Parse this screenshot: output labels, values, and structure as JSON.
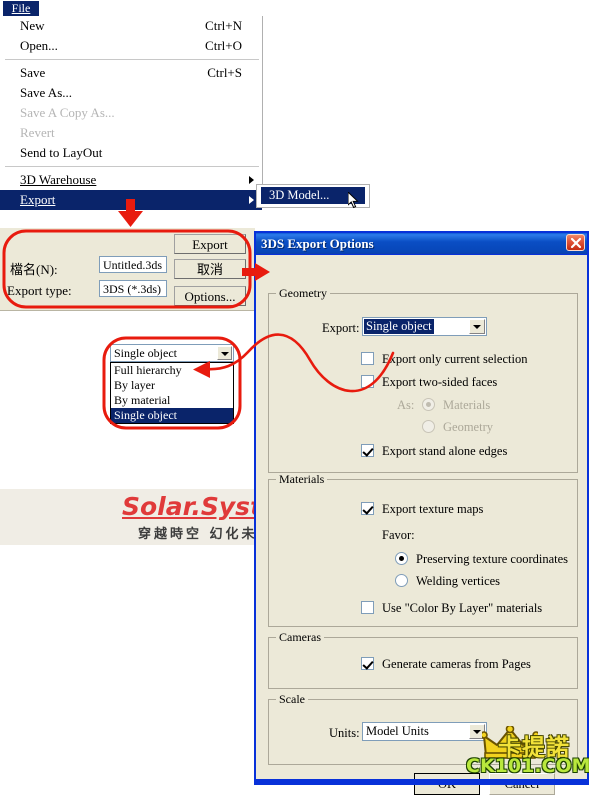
{
  "file_menu": {
    "title": "File",
    "title_underline_char": "F",
    "items": [
      {
        "label": "New",
        "accel": "Ctrl+N",
        "state": "normal",
        "underline": "N"
      },
      {
        "label": "Open...",
        "accel": "Ctrl+O",
        "state": "normal",
        "underline": "O"
      },
      {
        "separator": true
      },
      {
        "label": "Save",
        "accel": "Ctrl+S",
        "state": "normal",
        "underline": "S"
      },
      {
        "label": "Save As...",
        "accel": "",
        "state": "normal",
        "underline": ""
      },
      {
        "label": "Save A Copy As...",
        "accel": "",
        "state": "disabled",
        "underline": ""
      },
      {
        "label": "Revert",
        "accel": "",
        "state": "disabled",
        "underline": ""
      },
      {
        "label": "Send to LayOut",
        "accel": "",
        "state": "normal",
        "underline": ""
      },
      {
        "separator": true
      },
      {
        "label": "3D Warehouse",
        "accel": "",
        "state": "normal",
        "submenu": true,
        "underline": "3"
      },
      {
        "label": "Export",
        "accel": "",
        "state": "highlight",
        "submenu": true,
        "underline": "E"
      }
    ],
    "submenu": {
      "items": [
        {
          "label": "3D Model...",
          "state": "highlight"
        }
      ]
    }
  },
  "save_dialog": {
    "filename_label": "檔名(N):",
    "filename_value": "Untitled.3ds",
    "export_type_label": "Export type:",
    "export_type_value": "3DS (*.3ds)",
    "buttons": {
      "export": "Export",
      "cancel": "取消",
      "options": "Options..."
    }
  },
  "open_dropdown": {
    "selected": "Single object",
    "options": [
      {
        "label": "Full hierarchy",
        "selected": false
      },
      {
        "label": "By layer",
        "selected": false
      },
      {
        "label": "By material",
        "selected": false
      },
      {
        "label": "Single object",
        "selected": true
      }
    ]
  },
  "export_options_dialog": {
    "title": "3DS Export Options",
    "close_button_label": "×",
    "geometry": {
      "legend": "Geometry",
      "export_label": "Export:",
      "export_value": "Single object",
      "checkboxes": [
        {
          "label": "Export only current selection",
          "checked": false,
          "enabled": true
        },
        {
          "label": "Export two-sided faces",
          "checked": false,
          "enabled": true
        },
        {
          "label": "Export stand alone edges",
          "checked": true,
          "enabled": true
        }
      ],
      "as_label": "As:",
      "as_options": [
        {
          "label": "Materials",
          "checked": true,
          "enabled": false
        },
        {
          "label": "Geometry",
          "checked": false,
          "enabled": false
        }
      ]
    },
    "materials": {
      "legend": "Materials",
      "export_texture_maps": {
        "label": "Export texture maps",
        "checked": true
      },
      "favor_label": "Favor:",
      "favor_options": [
        {
          "label": "Preserving texture coordinates",
          "checked": true
        },
        {
          "label": "Welding vertices",
          "checked": false
        }
      ],
      "color_by_layer": {
        "label": "Use \"Color By Layer\" materials",
        "checked": false
      }
    },
    "cameras": {
      "legend": "Cameras",
      "generate_cameras": {
        "label": "Generate cameras from Pages",
        "checked": true
      }
    },
    "scale": {
      "legend": "Scale",
      "units_label": "Units:",
      "units_value": "Model Units"
    },
    "buttons": {
      "ok": "OK",
      "cancel": "Cancel"
    }
  },
  "watermarks": {
    "solar_title": "Solar.System",
    "solar_subtitle": "穿越時空  幻化未來",
    "ck_chinese": "卡提諾",
    "ck_domain": "CK101.COM"
  },
  "colors": {
    "menu_highlight": "#0a246a",
    "dialog_face": "#ece9d8",
    "titlebar_blue": "#0831d9",
    "annotation_red": "#e81b0e",
    "close_red": "#c42b11",
    "watermark_red": "#e03a3a",
    "ck_yellow": "#f2e23a",
    "ck_green": "#b9e83d"
  }
}
